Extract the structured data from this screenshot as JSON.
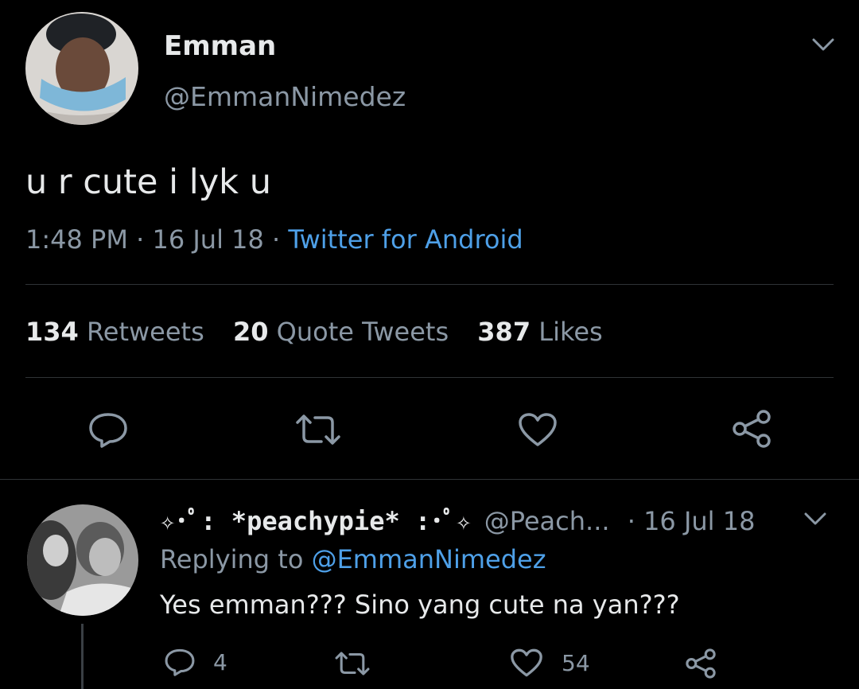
{
  "tweet": {
    "author_name": "Emman",
    "author_handle": "@EmmanNimedez",
    "text": "u r cute i lyk u",
    "time": "1:48 PM",
    "date": "16 Jul 18",
    "source": "Twitter for Android",
    "sep": "·",
    "stats": {
      "retweets_count": "134",
      "retweets_label": "Retweets",
      "quotes_count": "20",
      "quotes_label": "Quote Tweets",
      "likes_count": "387",
      "likes_label": "Likes"
    }
  },
  "reply": {
    "author_name": "✧･ﾟ: *peachypie* :･ﾟ✧",
    "author_handle": "@Peach...",
    "date": "· 16 Jul 18",
    "replying_prefix": "Replying to",
    "replying_handle": "@EmmanNimedez",
    "text": "Yes emman??? Sino yang cute na yan???",
    "reply_count": "4",
    "like_count": "54"
  },
  "icons": {
    "chevron": "chevron-down-icon",
    "reply": "reply-icon",
    "retweet": "retweet-icon",
    "like": "heart-icon",
    "share": "share-icon"
  },
  "colors": {
    "background": "#000000",
    "text": "#d9d9d9",
    "muted": "#8b98a5",
    "link": "#4ea0e8",
    "divider": "#2f3336"
  }
}
